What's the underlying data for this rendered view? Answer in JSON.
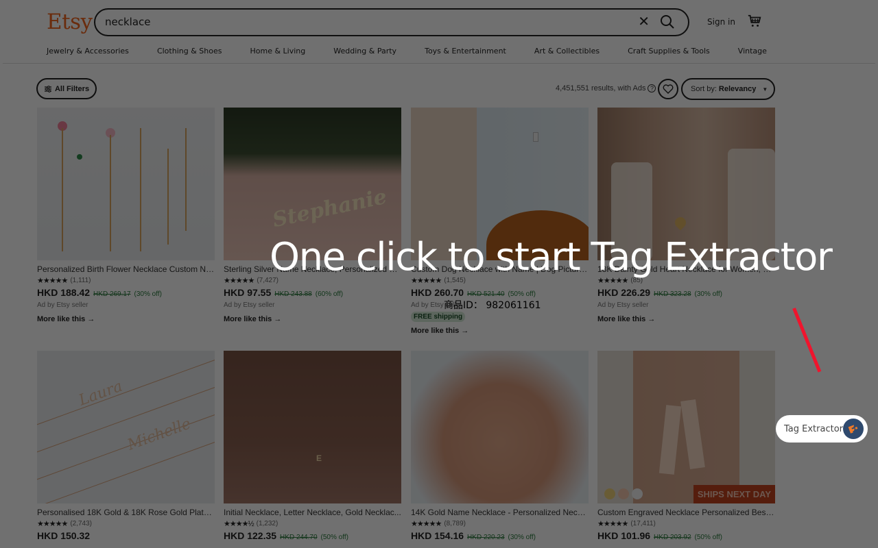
{
  "header": {
    "logo": "Etsy",
    "search_value": "necklace",
    "sign_in": "Sign in",
    "categories": [
      "Jewelry & Accessories",
      "Clothing & Shoes",
      "Home & Living",
      "Wedding & Party",
      "Toys & Entertainment",
      "Art & Collectibles",
      "Craft Supplies & Tools",
      "Vintage"
    ]
  },
  "toolbar": {
    "filters_label": "All Filters",
    "results_text": "4,451,551 results, with Ads",
    "sort_prefix": "Sort by:",
    "sort_value": "Relevancy"
  },
  "products": [
    {
      "title": "Personalized Birth Flower Necklace Custom Na...",
      "stars": "★★★★★",
      "reviews": "(1,111)",
      "price": "HKD 188.42",
      "original": "HKD 269.17",
      "discount": "(30% off)",
      "ad": "Ad by Etsy seller",
      "free_shipping": "",
      "more": "More like this →"
    },
    {
      "title": "Sterling Silver Name Necklace, Personalized Je...",
      "stars": "★★★★★",
      "reviews": "(7,427)",
      "price": "HKD 97.55",
      "original": "HKD 243.88",
      "discount": "(60% off)",
      "ad": "Ad by Etsy seller",
      "free_shipping": "",
      "more": "More like this →"
    },
    {
      "title": "Custom Dog Necklace with Name | Dog Picture...",
      "stars": "★★★★★",
      "reviews": "(1,545)",
      "price": "HKD 260.70",
      "original": "HKD 521.40",
      "discount": "(50% off)",
      "ad": "Ad by Etsy seller",
      "free_shipping": "FREE shipping",
      "more": "More like this →"
    },
    {
      "title": "18K Dainty Gold Heart Necklace for Women, M...",
      "stars": "★★★★★",
      "reviews": "(85)",
      "price": "HKD 226.29",
      "original": "HKD 323.28",
      "discount": "(30% off)",
      "ad": "Ad by Etsy seller",
      "free_shipping": "",
      "more": "More like this →"
    },
    {
      "title": "Personalised 18K Gold & 18K Rose Gold Plated ...",
      "stars": "★★★★★",
      "reviews": "(2,743)",
      "price": "HKD 150.32",
      "original": "",
      "discount": "",
      "ad": "",
      "free_shipping": "",
      "more": ""
    },
    {
      "title": "Initial Necklace, Letter Necklace, Gold Necklac...",
      "stars": "★★★★½",
      "reviews": "(1,232)",
      "price": "HKD 122.35",
      "original": "HKD 244.70",
      "discount": "(50% off)",
      "ad": "",
      "free_shipping": "",
      "more": ""
    },
    {
      "title": "14K Gold Name Necklace - Personalized Neckla...",
      "stars": "★★★★★",
      "reviews": "(8,789)",
      "price": "HKD 154.16",
      "original": "HKD 220.23",
      "discount": "(30% off)",
      "ad": "",
      "free_shipping": "",
      "more": ""
    },
    {
      "title": "Custom Engraved Necklace Personalized Best ...",
      "stars": "★★★★★",
      "reviews": "(17,411)",
      "price": "HKD 101.96",
      "original": "HKD 203.92",
      "discount": "(50% off)",
      "ad": "",
      "free_shipping": "",
      "more": "",
      "badge": "SHIPS NEXT DAY"
    }
  ],
  "overlay": {
    "headline": "One click to start Tag Extractor",
    "product_id": "商品ID： 982061161",
    "extension_button": "Tag Extractor"
  },
  "colors": {
    "brand": "#f1641e",
    "discount_green": "#2a7a3d",
    "arrow_red": "#f0142d",
    "extension_logo_bg": "#2f4a6e",
    "extension_logo_fg": "#f07a28"
  }
}
